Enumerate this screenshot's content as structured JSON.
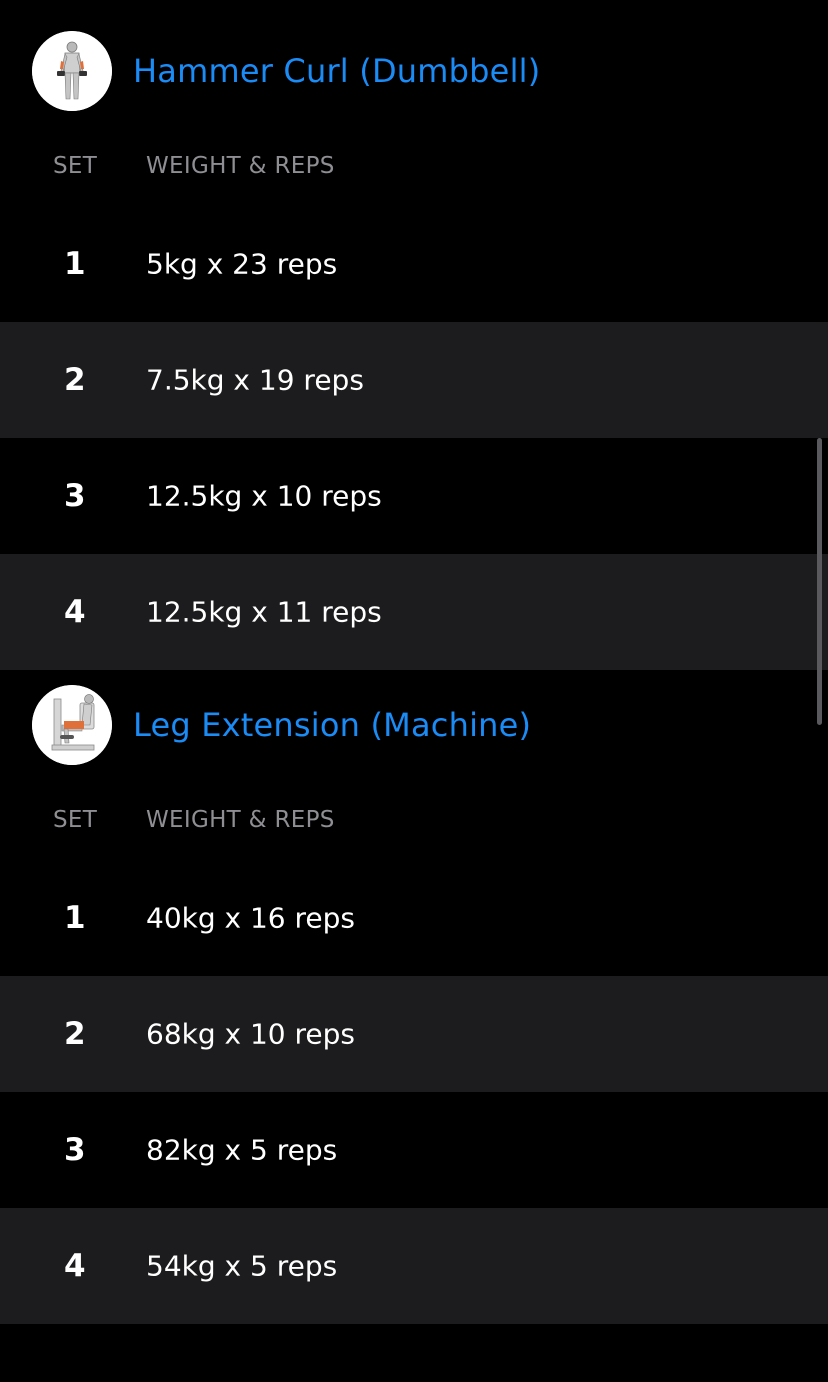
{
  "exercises": [
    {
      "title": "Hammer Curl (Dumbbell)",
      "icon": "hammer-curl-figure-icon",
      "col_set": "SET",
      "col_weight_reps": "WEIGHT & REPS",
      "sets": [
        {
          "num": "1",
          "value": "5kg x 23 reps"
        },
        {
          "num": "2",
          "value": "7.5kg x 19 reps"
        },
        {
          "num": "3",
          "value": "12.5kg x 10 reps"
        },
        {
          "num": "4",
          "value": "12.5kg x 11 reps"
        }
      ]
    },
    {
      "title": "Leg Extension (Machine)",
      "icon": "leg-extension-machine-icon",
      "col_set": "SET",
      "col_weight_reps": "WEIGHT & REPS",
      "sets": [
        {
          "num": "1",
          "value": "40kg x 16 reps"
        },
        {
          "num": "2",
          "value": "68kg x 10 reps"
        },
        {
          "num": "3",
          "value": "82kg x 5 reps"
        },
        {
          "num": "4",
          "value": "54kg x 5 reps"
        }
      ]
    }
  ],
  "colors": {
    "accent": "#1b8bf5",
    "background": "#000000",
    "alt_row": "#1c1c1e",
    "muted_text": "#8e8e93",
    "muscle_highlight": "#e0703a"
  }
}
